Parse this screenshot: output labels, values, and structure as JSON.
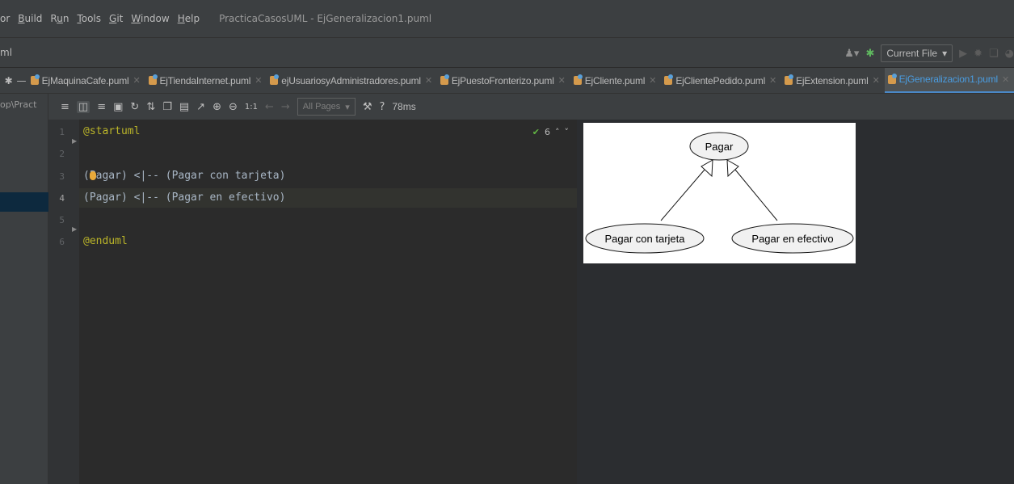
{
  "menu": {
    "items": [
      {
        "pre": "",
        "u": "",
        "rest": "or"
      },
      {
        "pre": "",
        "u": "B",
        "rest": "uild"
      },
      {
        "pre": "R",
        "u": "u",
        "rest": "n"
      },
      {
        "pre": "",
        "u": "T",
        "rest": "ools"
      },
      {
        "pre": "",
        "u": "G",
        "rest": "it"
      },
      {
        "pre": "",
        "u": "W",
        "rest": "indow"
      },
      {
        "pre": "",
        "u": "H",
        "rest": "elp"
      }
    ],
    "title": "PracticaCasosUML - EjGeneralizacion1.puml"
  },
  "navbar": {
    "crumb": "ml",
    "run_config": "Current File"
  },
  "tabs": [
    {
      "label": "EjMaquinaCafe.puml",
      "active": false
    },
    {
      "label": "EjTiendaInternet.puml",
      "active": false
    },
    {
      "label": "ejUsuariosyAdministradores.puml",
      "active": false
    },
    {
      "label": "EjPuestoFronterizo.puml",
      "active": false
    },
    {
      "label": "EjCliente.puml",
      "active": false
    },
    {
      "label": "EjClientePedido.puml",
      "active": false
    },
    {
      "label": "EjExtension.puml",
      "active": false
    },
    {
      "label": "EjGeneralizacion1.puml",
      "active": true
    }
  ],
  "project_path": "op\\Pract",
  "toolbar": {
    "zoom_actual": "1:1",
    "pages": "All Pages",
    "help": "?",
    "render_time": "78ms"
  },
  "editor": {
    "line_numbers": [
      "1",
      "2",
      "3",
      "4",
      "5",
      "6"
    ],
    "lines": {
      "l1": "@startuml",
      "l3": "(Pagar) <|-- (Pagar con tarjeta)",
      "l4": "(Pagar) <|-- (Pagar en efectivo)",
      "l6": "@enduml"
    },
    "inspection_count": "6"
  },
  "diagram": {
    "parent": "Pagar",
    "child_left": "Pagar con tarjeta",
    "child_right": "Pagar en efectivo"
  }
}
